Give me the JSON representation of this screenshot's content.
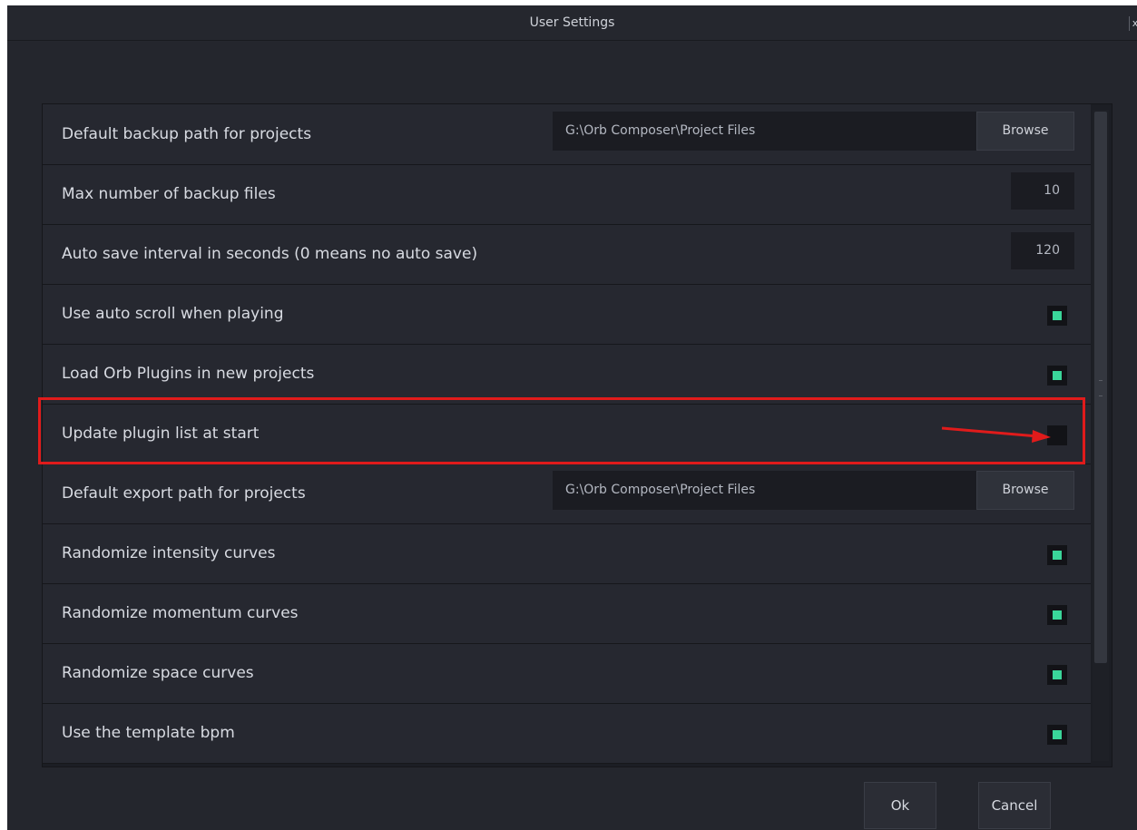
{
  "window": {
    "title": "User Settings",
    "close_label": "x"
  },
  "settings": [
    {
      "label": "Default backup path for projects",
      "type": "path",
      "value": "G:\\Orb Composer\\Project Files",
      "button": "Browse"
    },
    {
      "label": "Max number of backup files",
      "type": "number",
      "value": "10"
    },
    {
      "label": "Auto save interval in seconds (0 means no auto save)",
      "type": "number",
      "value": "120"
    },
    {
      "label": "Use auto scroll when playing",
      "type": "checkbox",
      "checked": true
    },
    {
      "label": "Load Orb Plugins in new projects",
      "type": "checkbox",
      "checked": true
    },
    {
      "label": "Update plugin list at start",
      "type": "checkbox",
      "checked": false
    },
    {
      "label": "Default export path for projects",
      "type": "path",
      "value": "G:\\Orb Composer\\Project Files",
      "button": "Browse"
    },
    {
      "label": "Randomize intensity curves",
      "type": "checkbox",
      "checked": true
    },
    {
      "label": "Randomize momentum curves",
      "type": "checkbox",
      "checked": true
    },
    {
      "label": "Randomize space curves",
      "type": "checkbox",
      "checked": true
    },
    {
      "label": "Use the template bpm",
      "type": "checkbox",
      "checked": true
    }
  ],
  "footer": {
    "ok_label": "Ok",
    "cancel_label": "Cancel"
  },
  "annotation": {
    "highlight_color": "#e01b1b"
  },
  "colors": {
    "accent_check": "#3ad69a",
    "background": "#24262d"
  }
}
